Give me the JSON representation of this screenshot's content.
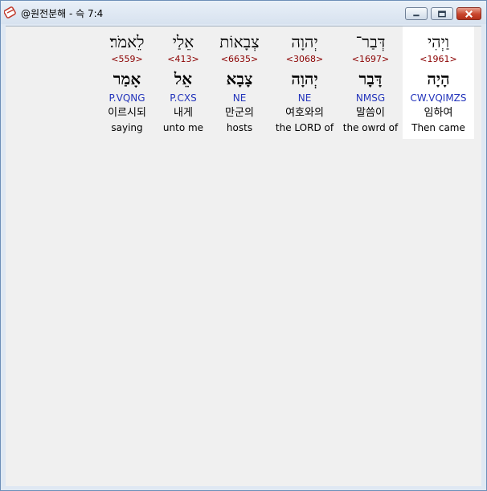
{
  "window": {
    "title": "@원전분해 - 슥 7:4",
    "controls": {
      "minimize": "minimize",
      "maximize": "maximize",
      "close": "close"
    }
  },
  "words": [
    {
      "hebrew": "וַיְהִי",
      "strong": "<1961>",
      "lemma": "הָיָה",
      "parsing": "CW.VQIMZS",
      "korean": "임하여",
      "english": "Then came",
      "selected": true
    },
    {
      "hebrew": "דְּבַר־",
      "strong": "<1697>",
      "lemma": "דָּבָר",
      "parsing": "NMSG",
      "korean": "말씀이",
      "english": "the owrd of",
      "selected": false
    },
    {
      "hebrew": "יְהוָה",
      "strong": "<3068>",
      "lemma": "יְהוָה",
      "parsing": "NE",
      "korean": "여호와의",
      "english": "the LORD of",
      "selected": false
    },
    {
      "hebrew": "צְבָאוֹת",
      "strong": "<6635>",
      "lemma": "צָבָא",
      "parsing": "NE",
      "korean": "만군의",
      "english": "hosts",
      "selected": false
    },
    {
      "hebrew": "אֵלַי",
      "strong": "<413>",
      "lemma": "אֵל",
      "parsing": "P.CXS",
      "korean": "내게",
      "english": "unto me",
      "selected": false
    },
    {
      "hebrew": "לֵאמֹר׃",
      "strong": "<559>",
      "lemma": "אָמַר",
      "parsing": "P.VQNG",
      "korean": "이르시되",
      "english": "saying",
      "selected": false
    }
  ]
}
